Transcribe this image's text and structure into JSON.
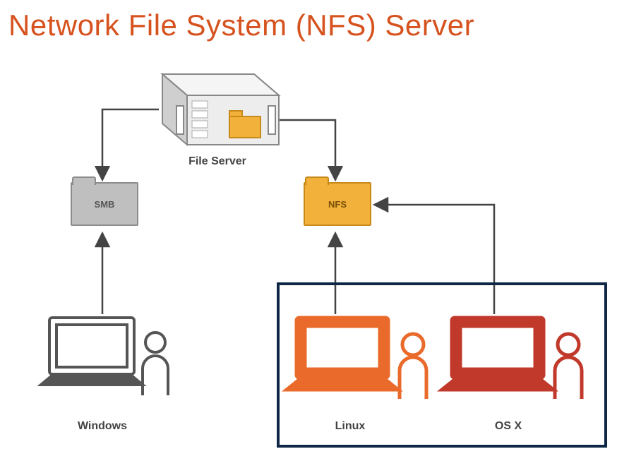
{
  "title": "Network File System (NFS) Server",
  "nodes": {
    "server": {
      "label": "File Server"
    },
    "smb": {
      "label": "SMB"
    },
    "nfs": {
      "label": "NFS"
    },
    "windows": {
      "label": "Windows"
    },
    "linux": {
      "label": "Linux"
    },
    "osx": {
      "label": "OS X"
    }
  },
  "edges": [
    {
      "from": "server",
      "to": "smb"
    },
    {
      "from": "server",
      "to": "nfs"
    },
    {
      "from": "windows",
      "to": "smb"
    },
    {
      "from": "linux",
      "to": "nfs"
    },
    {
      "from": "osx",
      "to": "nfs"
    }
  ],
  "highlight": [
    "linux",
    "osx"
  ],
  "colors": {
    "title": "#d6521e",
    "smb_folder": "#bfbfbf",
    "nfs_folder": "#f2b13a",
    "linux": "#e96a2a",
    "osx": "#c0392b",
    "windows": "#555555",
    "highlight_border": "#0d2745"
  }
}
